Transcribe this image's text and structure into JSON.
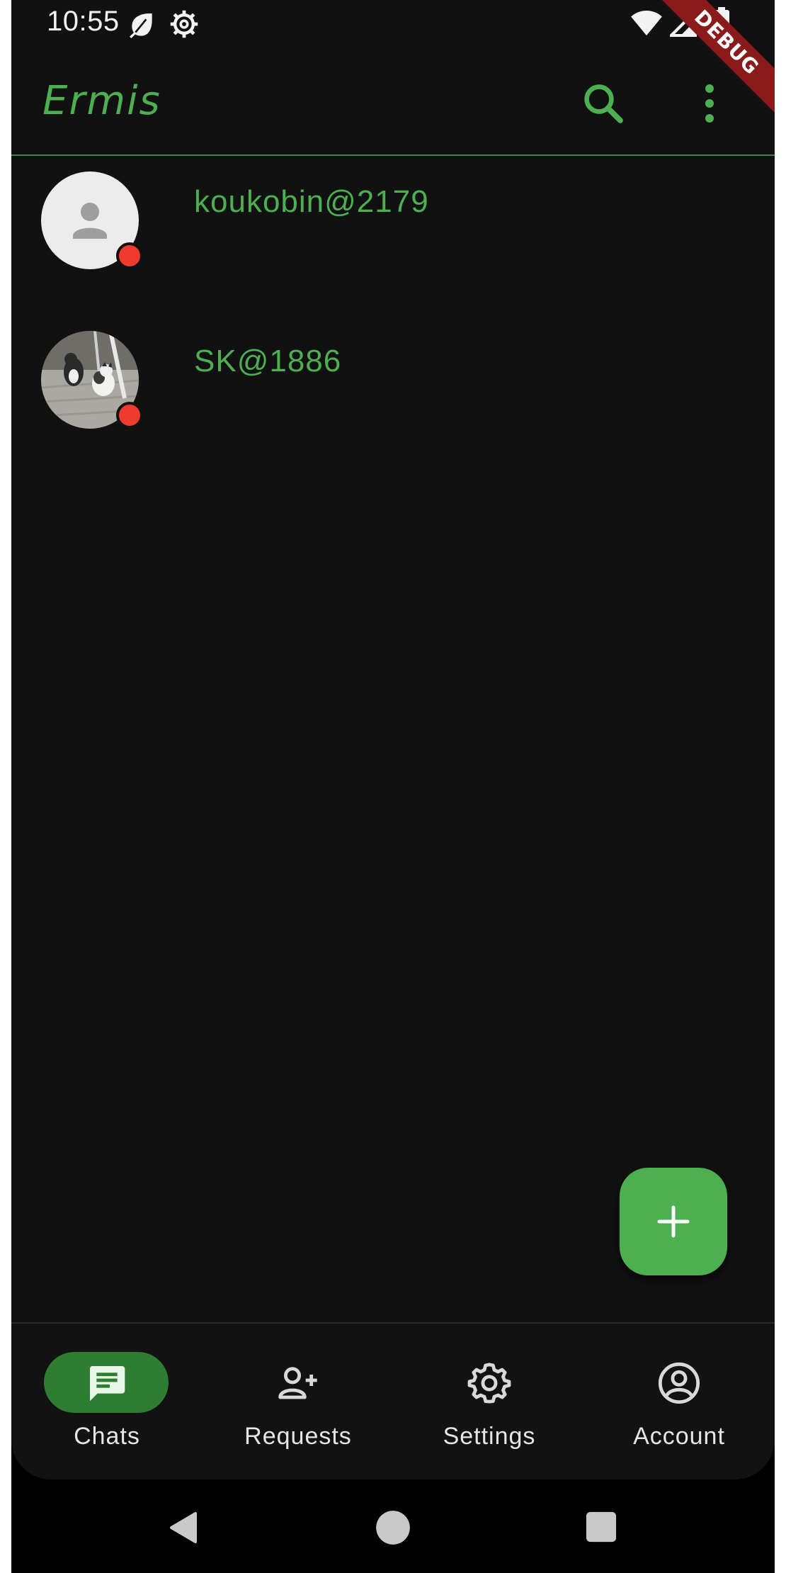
{
  "status_bar": {
    "time": "10:55",
    "left_icons": [
      "leaf-icon",
      "settings-gear-icon"
    ],
    "right_icons": [
      "wifi-icon",
      "cell-signal-icon",
      "battery-icon"
    ]
  },
  "debug_banner": "DEBUG",
  "app_bar": {
    "title": "Ermis",
    "actions": [
      "search-icon",
      "more-vert-icon"
    ]
  },
  "chats": [
    {
      "name": "koukobin@2179",
      "avatar": "default-person",
      "online": false
    },
    {
      "name": "SK@1886",
      "avatar": "photo-cats",
      "online": false
    }
  ],
  "fab": {
    "icon": "plus-icon"
  },
  "bottom_nav": {
    "active": "Chats",
    "items": [
      {
        "label": "Chats",
        "icon": "chat-icon"
      },
      {
        "label": "Requests",
        "icon": "person-add-icon"
      },
      {
        "label": "Settings",
        "icon": "gear-icon"
      },
      {
        "label": "Account",
        "icon": "account-circle-icon"
      }
    ]
  },
  "system_nav": [
    "back-icon",
    "home-icon",
    "recents-icon"
  ],
  "colors": {
    "accent": "#4caf50",
    "background": "#111111",
    "nav_active_pill": "#2e7d32",
    "offline_dot": "#ef3b2d",
    "debug_banner": "#8b1a1a"
  }
}
